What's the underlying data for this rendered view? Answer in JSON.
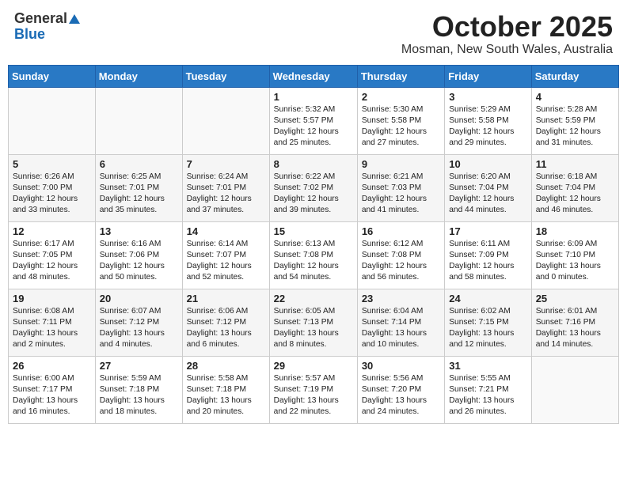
{
  "logo": {
    "general": "General",
    "blue": "Blue"
  },
  "title": "October 2025",
  "location": "Mosman, New South Wales, Australia",
  "days_of_week": [
    "Sunday",
    "Monday",
    "Tuesday",
    "Wednesday",
    "Thursday",
    "Friday",
    "Saturday"
  ],
  "weeks": [
    [
      {
        "day": "",
        "info": ""
      },
      {
        "day": "",
        "info": ""
      },
      {
        "day": "",
        "info": ""
      },
      {
        "day": "1",
        "info": "Sunrise: 5:32 AM\nSunset: 5:57 PM\nDaylight: 12 hours\nand 25 minutes."
      },
      {
        "day": "2",
        "info": "Sunrise: 5:30 AM\nSunset: 5:58 PM\nDaylight: 12 hours\nand 27 minutes."
      },
      {
        "day": "3",
        "info": "Sunrise: 5:29 AM\nSunset: 5:58 PM\nDaylight: 12 hours\nand 29 minutes."
      },
      {
        "day": "4",
        "info": "Sunrise: 5:28 AM\nSunset: 5:59 PM\nDaylight: 12 hours\nand 31 minutes."
      }
    ],
    [
      {
        "day": "5",
        "info": "Sunrise: 6:26 AM\nSunset: 7:00 PM\nDaylight: 12 hours\nand 33 minutes."
      },
      {
        "day": "6",
        "info": "Sunrise: 6:25 AM\nSunset: 7:01 PM\nDaylight: 12 hours\nand 35 minutes."
      },
      {
        "day": "7",
        "info": "Sunrise: 6:24 AM\nSunset: 7:01 PM\nDaylight: 12 hours\nand 37 minutes."
      },
      {
        "day": "8",
        "info": "Sunrise: 6:22 AM\nSunset: 7:02 PM\nDaylight: 12 hours\nand 39 minutes."
      },
      {
        "day": "9",
        "info": "Sunrise: 6:21 AM\nSunset: 7:03 PM\nDaylight: 12 hours\nand 41 minutes."
      },
      {
        "day": "10",
        "info": "Sunrise: 6:20 AM\nSunset: 7:04 PM\nDaylight: 12 hours\nand 44 minutes."
      },
      {
        "day": "11",
        "info": "Sunrise: 6:18 AM\nSunset: 7:04 PM\nDaylight: 12 hours\nand 46 minutes."
      }
    ],
    [
      {
        "day": "12",
        "info": "Sunrise: 6:17 AM\nSunset: 7:05 PM\nDaylight: 12 hours\nand 48 minutes."
      },
      {
        "day": "13",
        "info": "Sunrise: 6:16 AM\nSunset: 7:06 PM\nDaylight: 12 hours\nand 50 minutes."
      },
      {
        "day": "14",
        "info": "Sunrise: 6:14 AM\nSunset: 7:07 PM\nDaylight: 12 hours\nand 52 minutes."
      },
      {
        "day": "15",
        "info": "Sunrise: 6:13 AM\nSunset: 7:08 PM\nDaylight: 12 hours\nand 54 minutes."
      },
      {
        "day": "16",
        "info": "Sunrise: 6:12 AM\nSunset: 7:08 PM\nDaylight: 12 hours\nand 56 minutes."
      },
      {
        "day": "17",
        "info": "Sunrise: 6:11 AM\nSunset: 7:09 PM\nDaylight: 12 hours\nand 58 minutes."
      },
      {
        "day": "18",
        "info": "Sunrise: 6:09 AM\nSunset: 7:10 PM\nDaylight: 13 hours\nand 0 minutes."
      }
    ],
    [
      {
        "day": "19",
        "info": "Sunrise: 6:08 AM\nSunset: 7:11 PM\nDaylight: 13 hours\nand 2 minutes."
      },
      {
        "day": "20",
        "info": "Sunrise: 6:07 AM\nSunset: 7:12 PM\nDaylight: 13 hours\nand 4 minutes."
      },
      {
        "day": "21",
        "info": "Sunrise: 6:06 AM\nSunset: 7:12 PM\nDaylight: 13 hours\nand 6 minutes."
      },
      {
        "day": "22",
        "info": "Sunrise: 6:05 AM\nSunset: 7:13 PM\nDaylight: 13 hours\nand 8 minutes."
      },
      {
        "day": "23",
        "info": "Sunrise: 6:04 AM\nSunset: 7:14 PM\nDaylight: 13 hours\nand 10 minutes."
      },
      {
        "day": "24",
        "info": "Sunrise: 6:02 AM\nSunset: 7:15 PM\nDaylight: 13 hours\nand 12 minutes."
      },
      {
        "day": "25",
        "info": "Sunrise: 6:01 AM\nSunset: 7:16 PM\nDaylight: 13 hours\nand 14 minutes."
      }
    ],
    [
      {
        "day": "26",
        "info": "Sunrise: 6:00 AM\nSunset: 7:17 PM\nDaylight: 13 hours\nand 16 minutes."
      },
      {
        "day": "27",
        "info": "Sunrise: 5:59 AM\nSunset: 7:18 PM\nDaylight: 13 hours\nand 18 minutes."
      },
      {
        "day": "28",
        "info": "Sunrise: 5:58 AM\nSunset: 7:18 PM\nDaylight: 13 hours\nand 20 minutes."
      },
      {
        "day": "29",
        "info": "Sunrise: 5:57 AM\nSunset: 7:19 PM\nDaylight: 13 hours\nand 22 minutes."
      },
      {
        "day": "30",
        "info": "Sunrise: 5:56 AM\nSunset: 7:20 PM\nDaylight: 13 hours\nand 24 minutes."
      },
      {
        "day": "31",
        "info": "Sunrise: 5:55 AM\nSunset: 7:21 PM\nDaylight: 13 hours\nand 26 minutes."
      },
      {
        "day": "",
        "info": ""
      }
    ]
  ]
}
